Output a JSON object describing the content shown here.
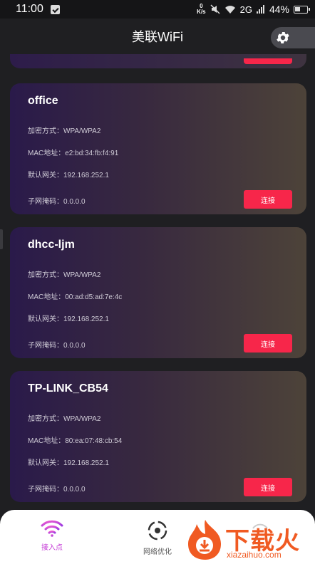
{
  "status_bar": {
    "time": "11:00",
    "speed_value": "0",
    "speed_unit": "K/s",
    "network": "2G",
    "battery": "44%"
  },
  "header": {
    "title": "美联WiFi",
    "settings_icon": "gear-icon"
  },
  "networks": [
    {
      "name": "office",
      "encryption_label": "加密方式：",
      "encryption": "WPA/WPA2",
      "mac_label": "MAC地址：",
      "mac": "e2:bd:34:fb:f4:91",
      "gateway_label": "默认网关：",
      "gateway": "192.168.252.1",
      "subnet_label": "子网掩码：",
      "subnet": "0.0.0.0",
      "connect_label": "连接"
    },
    {
      "name": "dhcc-ljm",
      "encryption_label": "加密方式：",
      "encryption": "WPA/WPA2",
      "mac_label": "MAC地址：",
      "mac": "00:ad:d5:ad:7e:4c",
      "gateway_label": "默认网关：",
      "gateway": "192.168.252.1",
      "subnet_label": "子网掩码：",
      "subnet": "0.0.0.0",
      "connect_label": "连接"
    },
    {
      "name": "TP-LINK_CB54",
      "encryption_label": "加密方式：",
      "encryption": "WPA/WPA2",
      "mac_label": "MAC地址：",
      "mac": "80:ea:07:48:cb:54",
      "gateway_label": "默认网关：",
      "gateway": "192.168.252.1",
      "subnet_label": "子网掩码：",
      "subnet": "0.0.0.0",
      "connect_label": "连接"
    }
  ],
  "bottom_nav": {
    "items": [
      {
        "label": "接入点",
        "icon": "wifi-icon",
        "active": true
      },
      {
        "label": "网络优化",
        "icon": "target-icon",
        "active": false
      }
    ],
    "accent_color": "#c43bd6"
  },
  "watermark": {
    "text": "下载火",
    "sub": "xiazaihuo.com"
  },
  "colors": {
    "connect_button": "#f7264a",
    "background": "#1f1f22"
  }
}
